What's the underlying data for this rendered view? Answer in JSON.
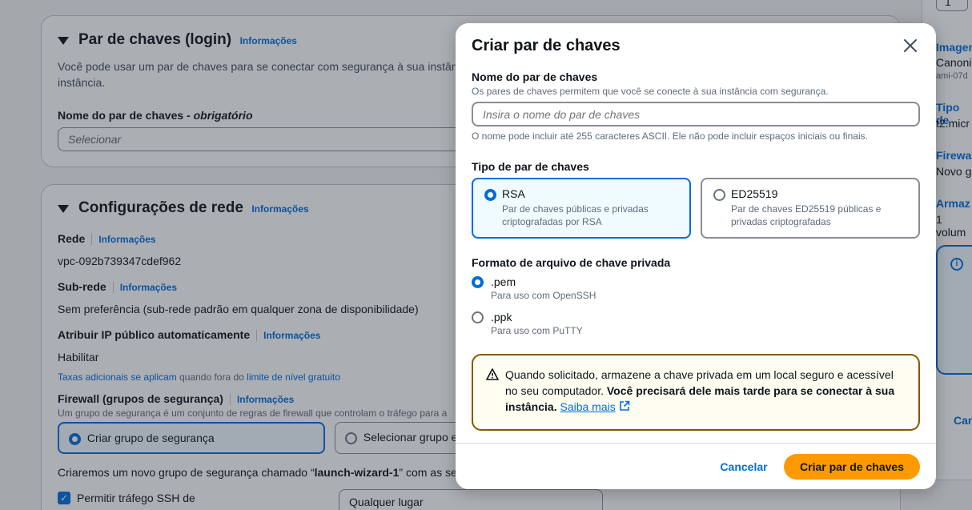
{
  "keypair_section": {
    "title": "Par de chaves (login)",
    "info": "Informações",
    "desc_line1": "Você pode usar um par de chaves para se conectar com segurança à sua instânc",
    "desc_line2": "instância.",
    "name_label": "Nome do par de chaves - ",
    "name_label_em": "obrigatório",
    "select_placeholder": "Selecionar"
  },
  "network_section": {
    "title": "Configurações de rede",
    "info": "Informações",
    "rede_label": "Rede",
    "rede_value": "vpc-092b739347cdef962",
    "subrede_label": "Sub-rede",
    "subrede_value": "Sem preferência (sub-rede padrão em qualquer zona de disponibilidade)",
    "ip_label": "Atribuir IP público automaticamente",
    "ip_value": "Habilitar",
    "fees_link": "Taxas adicionais se aplicam",
    "fees_mid": " quando fora do ",
    "fees_link2": "limite de nível gratuito",
    "firewall_label": "Firewall (grupos de segurança)",
    "firewall_desc": "Um grupo de segurança é um conjunto de regras de firewall que controlam o tráfego para a",
    "create_sg": "Criar grupo de segurança",
    "select_sg": "Selecionar grupo e",
    "create_note_pre": "Criaremos um novo grupo de segurança chamado “",
    "create_note_bold": "launch-wizard-1",
    "create_note_post": "” com as se",
    "ssh_label": "Permitir tráfego SSH de",
    "anywhere": "Qualquer lugar"
  },
  "right_panel": {
    "stepper_value": "1",
    "l1": "Imagen",
    "l2": "Canonic",
    "l3": "ami-07d",
    "l4": "Tipo de",
    "l5": "t2.micr",
    "l6": "Firewa",
    "l7": "Novo g",
    "l8": "Armaz",
    "l9": "1 volum",
    "cancel": "Can"
  },
  "modal": {
    "title": "Criar par de chaves",
    "name_label": "Nome do par de chaves",
    "name_desc": "Os pares de chaves permitem que você se conecte à sua instância com segurança.",
    "name_placeholder": "Insira o nome do par de chaves",
    "name_constraint": "O nome pode incluir até 255 caracteres ASCII. Ele não pode incluir espaços iniciais ou finais.",
    "type_label": "Tipo de par de chaves",
    "rsa_title": "RSA",
    "rsa_desc1": "Par de chaves públicas e privadas",
    "rsa_desc2": "criptografadas por RSA",
    "ed_title": "ED25519",
    "ed_desc1": "Par de chaves ED25519 públicas e",
    "ed_desc2": "privadas criptografadas",
    "format_label": "Formato de arquivo de chave privada",
    "pem_title": ".pem",
    "pem_desc": "Para uso com OpenSSH",
    "ppk_title": ".ppk",
    "ppk_desc": "Para uso com PuTTY",
    "warn_text1": "Quando solicitado, armazene a chave privada em um local seguro e acessível",
    "warn_text2": "no seu computador. ",
    "warn_bold": "Você precisará dele mais tarde para se conectar à sua instância.",
    "warn_link": "Saiba mais",
    "cancel": "Cancelar",
    "create": "Criar par de chaves"
  },
  "colors": {
    "accent": "#006ce0",
    "primary_button": "#ff9900",
    "warning_border": "#855900"
  }
}
